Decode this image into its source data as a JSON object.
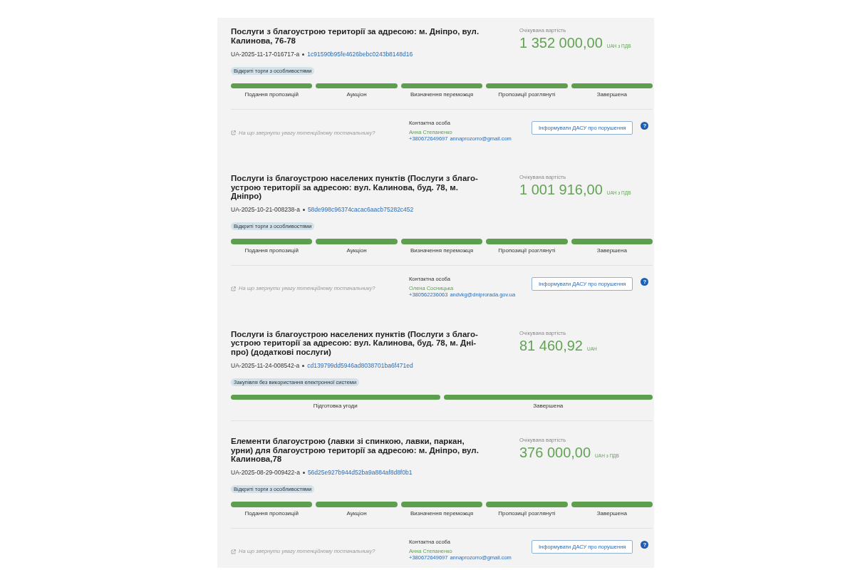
{
  "tenders": [
    {
      "title_lines": [
        "Послуги з благоустрою території за адресою: м. Дніпро, вул.",
        "Калинова, 76-78"
      ],
      "tender_id": "UA-2025-11-17-016717-a",
      "hash": "1c91590b95fe4626bebc0243b8148d16",
      "procedure": "Відкриті торги з особливостями",
      "value_label": "Очікувана вартість",
      "amount": "1 352 000,00",
      "currency": "UAH з ПДВ",
      "stages": [
        {
          "label": "Подання пропозицій",
          "completed": true
        },
        {
          "label": "Аукціон",
          "completed": true
        },
        {
          "label": "Визначення переможця",
          "completed": true
        },
        {
          "label": "Пропозиції розглянуті",
          "completed": true
        },
        {
          "label": "Завершена",
          "completed": true
        }
      ],
      "footer": {
        "hint": "На що звернути увагу потенційному постачальнику?",
        "contact_label": "Контактна особа",
        "contact_name": "Анна Степаненко",
        "phone": "+380672649697",
        "email": "annaprozorro@gmail.com",
        "report_button": "Інформувати ДАСУ про порушення",
        "help": "?"
      }
    },
    {
      "title_lines": [
        "Послуги із благоустрою населених пунктів (Послуги з благо-",
        "устрою території за адресою: вул. Калинова, буд. 78, м.",
        "Дніпро)"
      ],
      "tender_id": "UA-2025-10-21-008238-a",
      "hash": "58de998c96374cacac6aacb75282c452",
      "procedure": "Відкриті торги з особливостями",
      "value_label": "Очікувана вартість",
      "amount": "1 001 916,00",
      "currency": "UAH з ПДВ",
      "stages": [
        {
          "label": "Подання пропозицій",
          "completed": true
        },
        {
          "label": "Аукціон",
          "completed": true
        },
        {
          "label": "Визначення переможця",
          "completed": true
        },
        {
          "label": "Пропозиції розглянуті",
          "completed": true
        },
        {
          "label": "Завершена",
          "completed": true
        }
      ],
      "footer": {
        "hint": "На що звернути увагу потенційному постачальнику?",
        "contact_label": "Контактна особа",
        "contact_name": "Олена Сосницька",
        "phone": "+380562236063",
        "email": "andvkg@dniprorada.gov.ua",
        "report_button": "Інформувати ДАСУ про порушення",
        "help": "?"
      }
    },
    {
      "title_lines": [
        "Послуги із благоустрою населених пунктів (Послуги з благо-",
        "устрою території за адресою: вул. Калинова, буд. 78, м. Дні-",
        "про) (додаткові послуги)"
      ],
      "tender_id": "UA-2025-11-24-008542-a",
      "hash": "cd139799dd5946ad8038701ba6f471ed",
      "procedure": "Закупівля без використання електронної системи",
      "value_label": "Очікувана вартість",
      "amount": "81 460,92",
      "currency": "UAH",
      "stages": [
        {
          "label": "Підготовка угоди",
          "completed": true
        },
        {
          "label": "Завершена",
          "completed": true
        }
      ]
    },
    {
      "title_lines": [
        "Елементи благоустрою (лавки зі спинкою, лавки, паркан,",
        "урни) для благоустрою території за адресою: м. Дніпро, вул.",
        "Калинова,78"
      ],
      "tender_id": "UA-2025-08-29-009422-a",
      "hash": "56d25e927b944d52ba9a884af8d8f0b1",
      "procedure": "Відкриті торги з особливостями",
      "value_label": "Очікувана вартість",
      "amount": "376 000,00",
      "currency": "UAH з ПДВ",
      "stages": [
        {
          "label": "Подання пропозицій",
          "completed": true
        },
        {
          "label": "Аукціон",
          "completed": true
        },
        {
          "label": "Визначення переможця",
          "completed": true
        },
        {
          "label": "Пропозиції розглянуті",
          "completed": true
        },
        {
          "label": "Завершена",
          "completed": true
        }
      ],
      "footer": {
        "hint": "На що звернути увагу потенційному постачальнику?",
        "contact_label": "Контактна особа",
        "contact_name": "Анна Степаненко",
        "phone": "+380672649697",
        "email": "annaprozorro@gmail.com",
        "report_button": "Інформувати ДАСУ про порушення",
        "help": "?"
      }
    }
  ]
}
